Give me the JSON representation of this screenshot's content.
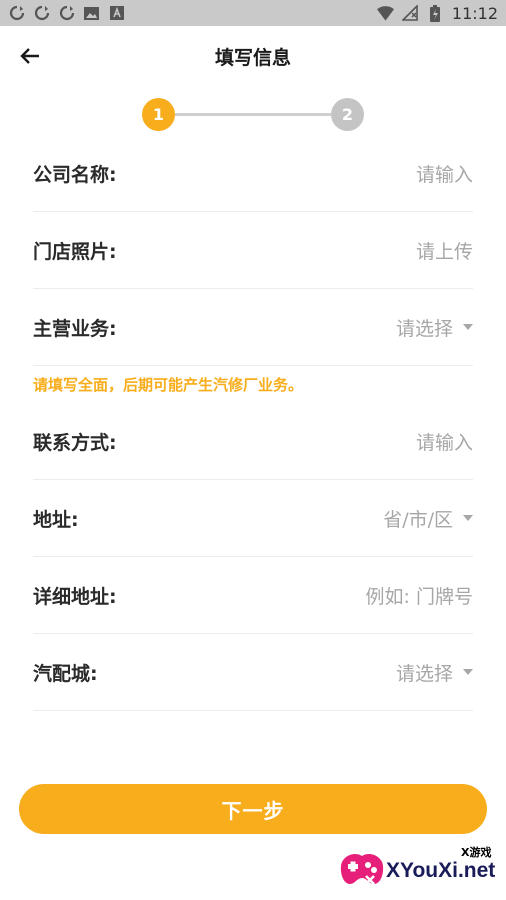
{
  "status_bar": {
    "time": "11:12",
    "left_icons": [
      "sync-icon",
      "sync-icon",
      "sync-icon",
      "image-icon",
      "app-badge-icon"
    ],
    "right_icons": [
      "wifi-icon",
      "no-sim-icon",
      "battery-icon"
    ]
  },
  "header": {
    "title": "填写信息"
  },
  "stepper": {
    "steps": [
      {
        "label": "1",
        "active": true
      },
      {
        "label": "2",
        "active": false
      }
    ],
    "active_color": "#f8ad1c",
    "inactive_color": "#c4c4c4"
  },
  "form": {
    "company_name": {
      "label": "公司名称:",
      "placeholder": "请输入"
    },
    "store_photo": {
      "label": "门店照片:",
      "placeholder": "请上传"
    },
    "main_business": {
      "label": "主营业务:",
      "placeholder": "请选择"
    },
    "warning": "请填写全面，后期可能产生汽修厂业务。",
    "contact": {
      "label": "联系方式:",
      "placeholder": "请输入"
    },
    "address": {
      "label": "地址:",
      "placeholder": "省/市/区"
    },
    "detail_address": {
      "label": "详细地址:",
      "placeholder": "例如: 门牌号"
    },
    "parts_city": {
      "label": "汽配城:",
      "placeholder": "请选择"
    }
  },
  "next_button": {
    "label": "下一步",
    "color": "#f8ad1c"
  },
  "watermark": {
    "small_text": "X游戏",
    "big_text": "XYouXi.net"
  }
}
